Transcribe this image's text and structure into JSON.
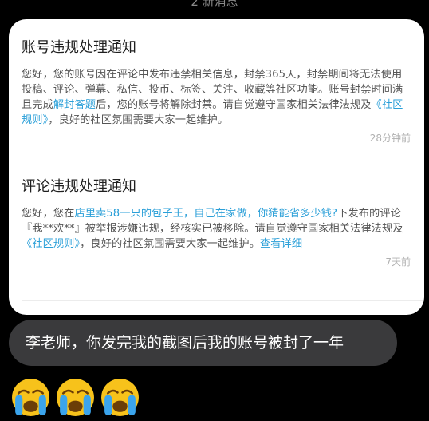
{
  "top_text": "2 新消息",
  "notices": [
    {
      "title": "账号违规处理通知",
      "body_parts": [
        {
          "text": "您好，您的账号因在评论中发布违禁相关信息，封禁365天，封禁期间将无法使用投稿、评论、弹幕、私信、投币、标签、关注、收藏等社区功能。账号封禁时间满且完成",
          "link": false
        },
        {
          "text": "解封答题",
          "link": true
        },
        {
          "text": "后，您的账号将解除封禁。请自觉遵守国家相关法律法规及",
          "link": false
        },
        {
          "text": "《社区规则》",
          "link": true
        },
        {
          "text": "，良好的社区氛围需要大家一起维护。",
          "link": false
        }
      ],
      "time": "28分钟前"
    },
    {
      "title": "评论违规处理通知",
      "body_parts": [
        {
          "text": "您好，您在",
          "link": false
        },
        {
          "text": "店里卖58一只的包子王，自己在家做，你猜能省多少钱?",
          "link": true
        },
        {
          "text": "下发布的评论『我**欢**』被举报涉嫌违规，经核实已被移除。请自觉遵守国家相关法律法规及",
          "link": false
        },
        {
          "text": "《社区规则》",
          "link": true
        },
        {
          "text": "，良好的社区氛围需要大家一起维护。",
          "link": false
        },
        {
          "text": "查看详细",
          "link": true
        }
      ],
      "time": "7天前"
    }
  ],
  "message": "李老师，你发完我的截图后我的账号被封了一年",
  "emojis": [
    "crying-face-icon",
    "crying-face-icon",
    "crying-face-icon"
  ],
  "colors": {
    "link": "#2a9fd8",
    "bubble": "#3a3a3c",
    "background": "#000000"
  }
}
